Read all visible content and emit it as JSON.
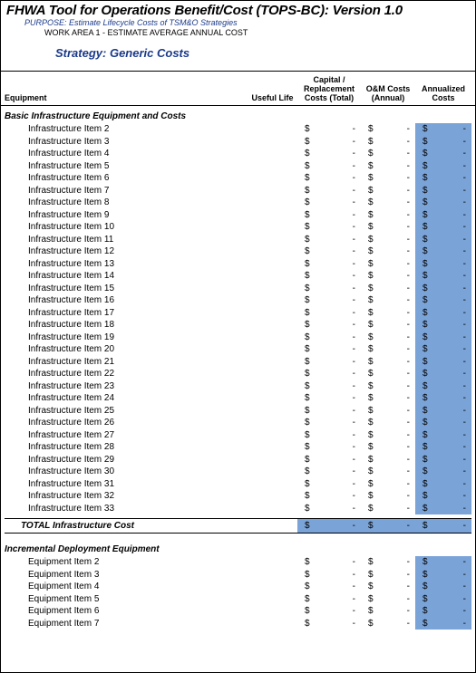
{
  "header": {
    "main_title": "FHWA Tool for Operations Benefit/Cost (TOPS-BC):  Version 1.0",
    "purpose": "PURPOSE:  Estimate Lifecycle Costs of TSM&O Strategies",
    "workarea": "WORK AREA 1 - ESTIMATE AVERAGE ANNUAL COST",
    "strategy": "Strategy:  Generic Costs"
  },
  "columns": {
    "equipment": "Equipment",
    "useful_life": "Useful Life",
    "capital": "Capital / Replacement Costs (Total)",
    "om": "O&M Costs (Annual)",
    "annualized": "Annualized Costs"
  },
  "sections": [
    {
      "title": "Basic Infrastructure Equipment and Costs",
      "rows": [
        {
          "name": "Infrastructure Item 2",
          "cap_sym": "$",
          "cap_val": "-",
          "om_sym": "$",
          "om_val": "-",
          "ann_sym": "$",
          "ann_val": "-"
        },
        {
          "name": "Infrastructure Item 3",
          "cap_sym": "$",
          "cap_val": "-",
          "om_sym": "$",
          "om_val": "-",
          "ann_sym": "$",
          "ann_val": "-"
        },
        {
          "name": "Infrastructure Item 4",
          "cap_sym": "$",
          "cap_val": "-",
          "om_sym": "$",
          "om_val": "-",
          "ann_sym": "$",
          "ann_val": "-"
        },
        {
          "name": "Infrastructure Item 5",
          "cap_sym": "$",
          "cap_val": "-",
          "om_sym": "$",
          "om_val": "-",
          "ann_sym": "$",
          "ann_val": "-"
        },
        {
          "name": "Infrastructure Item 6",
          "cap_sym": "$",
          "cap_val": "-",
          "om_sym": "$",
          "om_val": "-",
          "ann_sym": "$",
          "ann_val": "-"
        },
        {
          "name": "Infrastructure Item 7",
          "cap_sym": "$",
          "cap_val": "-",
          "om_sym": "$",
          "om_val": "-",
          "ann_sym": "$",
          "ann_val": "-"
        },
        {
          "name": "Infrastructure Item 8",
          "cap_sym": "$",
          "cap_val": "-",
          "om_sym": "$",
          "om_val": "-",
          "ann_sym": "$",
          "ann_val": "-"
        },
        {
          "name": "Infrastructure Item 9",
          "cap_sym": "$",
          "cap_val": "-",
          "om_sym": "$",
          "om_val": "-",
          "ann_sym": "$",
          "ann_val": "-"
        },
        {
          "name": "Infrastructure Item 10",
          "cap_sym": "$",
          "cap_val": "-",
          "om_sym": "$",
          "om_val": "-",
          "ann_sym": "$",
          "ann_val": "-"
        },
        {
          "name": "Infrastructure Item 11",
          "cap_sym": "$",
          "cap_val": "-",
          "om_sym": "$",
          "om_val": "-",
          "ann_sym": "$",
          "ann_val": "-"
        },
        {
          "name": "Infrastructure Item 12",
          "cap_sym": "$",
          "cap_val": "-",
          "om_sym": "$",
          "om_val": "-",
          "ann_sym": "$",
          "ann_val": "-"
        },
        {
          "name": "Infrastructure Item 13",
          "cap_sym": "$",
          "cap_val": "-",
          "om_sym": "$",
          "om_val": "-",
          "ann_sym": "$",
          "ann_val": "-"
        },
        {
          "name": "Infrastructure Item 14",
          "cap_sym": "$",
          "cap_val": "-",
          "om_sym": "$",
          "om_val": "-",
          "ann_sym": "$",
          "ann_val": "-"
        },
        {
          "name": "Infrastructure Item 15",
          "cap_sym": "$",
          "cap_val": "-",
          "om_sym": "$",
          "om_val": "-",
          "ann_sym": "$",
          "ann_val": "-"
        },
        {
          "name": "Infrastructure Item 16",
          "cap_sym": "$",
          "cap_val": "-",
          "om_sym": "$",
          "om_val": "-",
          "ann_sym": "$",
          "ann_val": "-"
        },
        {
          "name": "Infrastructure Item 17",
          "cap_sym": "$",
          "cap_val": "-",
          "om_sym": "$",
          "om_val": "-",
          "ann_sym": "$",
          "ann_val": "-"
        },
        {
          "name": "Infrastructure Item 18",
          "cap_sym": "$",
          "cap_val": "-",
          "om_sym": "$",
          "om_val": "-",
          "ann_sym": "$",
          "ann_val": "-"
        },
        {
          "name": "Infrastructure Item 19",
          "cap_sym": "$",
          "cap_val": "-",
          "om_sym": "$",
          "om_val": "-",
          "ann_sym": "$",
          "ann_val": "-"
        },
        {
          "name": "Infrastructure Item 20",
          "cap_sym": "$",
          "cap_val": "-",
          "om_sym": "$",
          "om_val": "-",
          "ann_sym": "$",
          "ann_val": "-"
        },
        {
          "name": "Infrastructure Item 21",
          "cap_sym": "$",
          "cap_val": "-",
          "om_sym": "$",
          "om_val": "-",
          "ann_sym": "$",
          "ann_val": "-"
        },
        {
          "name": "Infrastructure Item 22",
          "cap_sym": "$",
          "cap_val": "-",
          "om_sym": "$",
          "om_val": "-",
          "ann_sym": "$",
          "ann_val": "-"
        },
        {
          "name": "Infrastructure Item 23",
          "cap_sym": "$",
          "cap_val": "-",
          "om_sym": "$",
          "om_val": "-",
          "ann_sym": "$",
          "ann_val": "-"
        },
        {
          "name": "Infrastructure Item 24",
          "cap_sym": "$",
          "cap_val": "-",
          "om_sym": "$",
          "om_val": "-",
          "ann_sym": "$",
          "ann_val": "-"
        },
        {
          "name": "Infrastructure Item 25",
          "cap_sym": "$",
          "cap_val": "-",
          "om_sym": "$",
          "om_val": "-",
          "ann_sym": "$",
          "ann_val": "-"
        },
        {
          "name": "Infrastructure Item 26",
          "cap_sym": "$",
          "cap_val": "-",
          "om_sym": "$",
          "om_val": "-",
          "ann_sym": "$",
          "ann_val": "-"
        },
        {
          "name": "Infrastructure Item 27",
          "cap_sym": "$",
          "cap_val": "-",
          "om_sym": "$",
          "om_val": "-",
          "ann_sym": "$",
          "ann_val": "-"
        },
        {
          "name": "Infrastructure Item 28",
          "cap_sym": "$",
          "cap_val": "-",
          "om_sym": "$",
          "om_val": "-",
          "ann_sym": "$",
          "ann_val": "-"
        },
        {
          "name": "Infrastructure Item 29",
          "cap_sym": "$",
          "cap_val": "-",
          "om_sym": "$",
          "om_val": "-",
          "ann_sym": "$",
          "ann_val": "-"
        },
        {
          "name": "Infrastructure Item 30",
          "cap_sym": "$",
          "cap_val": "-",
          "om_sym": "$",
          "om_val": "-",
          "ann_sym": "$",
          "ann_val": "-"
        },
        {
          "name": "Infrastructure Item 31",
          "cap_sym": "$",
          "cap_val": "-",
          "om_sym": "$",
          "om_val": "-",
          "ann_sym": "$",
          "ann_val": "-"
        },
        {
          "name": "Infrastructure Item 32",
          "cap_sym": "$",
          "cap_val": "-",
          "om_sym": "$",
          "om_val": "-",
          "ann_sym": "$",
          "ann_val": "-"
        },
        {
          "name": "Infrastructure Item 33",
          "cap_sym": "$",
          "cap_val": "-",
          "om_sym": "$",
          "om_val": "-",
          "ann_sym": "$",
          "ann_val": "-"
        }
      ],
      "total": {
        "label": "TOTAL Infrastructure Cost",
        "cap_sym": "$",
        "cap_val": "-",
        "om_sym": "$",
        "om_val": "-",
        "ann_sym": "$",
        "ann_val": "-"
      }
    },
    {
      "title": "Incremental Deployment Equipment",
      "rows": [
        {
          "name": "Equipment Item 2",
          "cap_sym": "$",
          "cap_val": "-",
          "om_sym": "$",
          "om_val": "-",
          "ann_sym": "$",
          "ann_val": "-"
        },
        {
          "name": "Equipment Item 3",
          "cap_sym": "$",
          "cap_val": "-",
          "om_sym": "$",
          "om_val": "-",
          "ann_sym": "$",
          "ann_val": "-"
        },
        {
          "name": "Equipment Item 4",
          "cap_sym": "$",
          "cap_val": "-",
          "om_sym": "$",
          "om_val": "-",
          "ann_sym": "$",
          "ann_val": "-"
        },
        {
          "name": "Equipment Item 5",
          "cap_sym": "$",
          "cap_val": "-",
          "om_sym": "$",
          "om_val": "-",
          "ann_sym": "$",
          "ann_val": "-"
        },
        {
          "name": "Equipment Item 6",
          "cap_sym": "$",
          "cap_val": "-",
          "om_sym": "$",
          "om_val": "-",
          "ann_sym": "$",
          "ann_val": "-"
        },
        {
          "name": "Equipment Item 7",
          "cap_sym": "$",
          "cap_val": "-",
          "om_sym": "$",
          "om_val": "-",
          "ann_sym": "$",
          "ann_val": "-"
        }
      ]
    }
  ]
}
